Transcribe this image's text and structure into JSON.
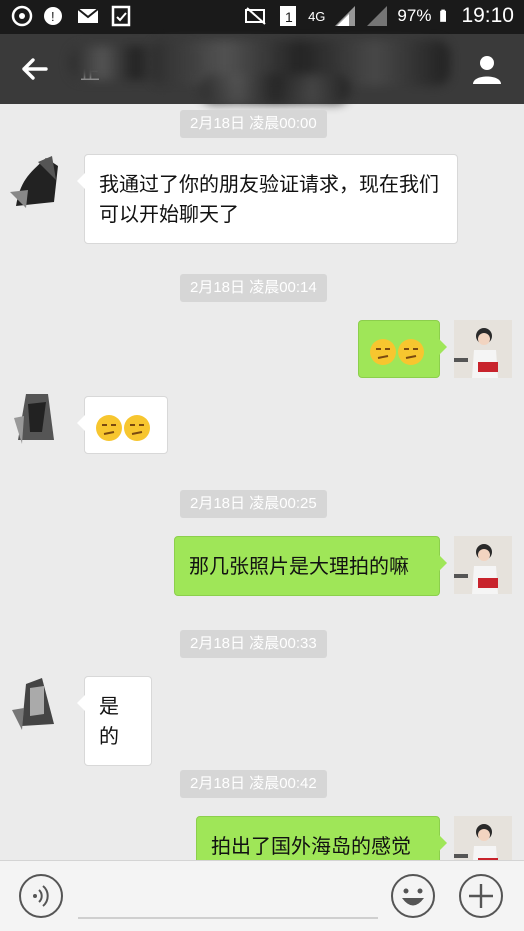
{
  "status_bar": {
    "network": "4G",
    "battery": "97%",
    "time": "19:10",
    "icons": [
      "sync-icon",
      "alert-icon",
      "mail-icon",
      "clipboard-icon",
      "mute-icon",
      "sim1-icon",
      "signal-icon",
      "battery-icon"
    ]
  },
  "header": {
    "title_fragment": "正",
    "back_icon": "arrow-left-icon",
    "profile_icon": "user-icon"
  },
  "messages": [
    {
      "type": "timestamp",
      "text": "2月18日 凌晨00:00"
    },
    {
      "type": "incoming",
      "text": "我通过了你的朋友验证请求，现在我们可以开始聊天了"
    },
    {
      "type": "timestamp",
      "text": "2月18日 凌晨00:14"
    },
    {
      "type": "outgoing",
      "emoji": [
        "smirk-emoji",
        "smirk-emoji"
      ]
    },
    {
      "type": "incoming",
      "emoji": [
        "smirk-emoji",
        "smirk-emoji"
      ]
    },
    {
      "type": "timestamp",
      "text": "2月18日 凌晨00:25"
    },
    {
      "type": "outgoing",
      "text": "那几张照片是大理拍的嘛"
    },
    {
      "type": "timestamp",
      "text": "2月18日 凌晨00:33"
    },
    {
      "type": "incoming",
      "text": "是的"
    },
    {
      "type": "timestamp",
      "text": "2月18日 凌晨00:42"
    },
    {
      "type": "outgoing",
      "text": "拍出了国外海岛的感觉"
    }
  ],
  "input_bar": {
    "voice_icon": "voice-icon",
    "emoji_icon": "smiley-icon",
    "plus_icon": "plus-icon"
  },
  "colors": {
    "header_bg": "#3a3a3a",
    "chat_bg": "#ebebeb",
    "outgoing_bubble": "#9fe658",
    "incoming_bubble": "#ffffff"
  }
}
